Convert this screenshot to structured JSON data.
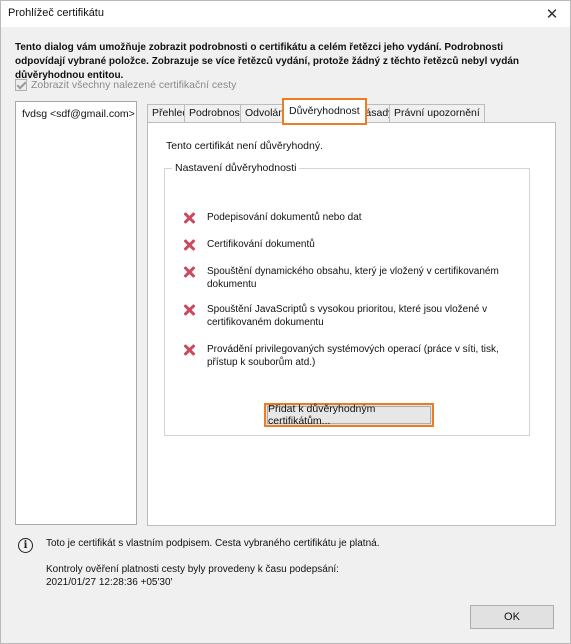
{
  "window": {
    "title": "Prohlížeč certifikátu",
    "intro": "Tento dialog vám umožňuje zobrazit podrobnosti o certifikátu a celém řetězci jeho vydání. Podrobnosti odpovídají vybrané položce. Zobrazuje se více řetězců vydání, protože žádný z těchto řetězců nebyl vydán důvěryhodnou entitou.",
    "show_all_label": "Zobrazit všechny nalezené certifikační cesty"
  },
  "cert_list": {
    "items": [
      "fvdsg <sdf@gmail.com>"
    ]
  },
  "tabs": [
    {
      "label": "Přehled"
    },
    {
      "label": "Podrobnosti"
    },
    {
      "label": "Odvolání"
    },
    {
      "label": "Důvěryhodnost"
    },
    {
      "label": "Zásady"
    },
    {
      "label": "Právní upozornění"
    }
  ],
  "trust_panel": {
    "status": "Tento certifikát není důvěryhodný.",
    "group_label": "Nastavení důvěryhodnosti",
    "items": [
      {
        "text": "Podepisování dokumentů nebo dat"
      },
      {
        "text": "Certifikování dokumentů"
      },
      {
        "text": "Spouštění dynamického obsahu, který je vložený v certifikovaném dokumentu"
      },
      {
        "text": "Spouštění JavaScriptů s vysokou prioritou, které jsou vložené v certifikovaném dokumentu"
      },
      {
        "text": "Provádění privilegovaných systémových operací (práce v síti, tisk, přístup k souborům atd.)"
      }
    ],
    "add_button": "Přidat k důvěryhodným certifikátům..."
  },
  "footer": {
    "info": "Toto je certifikát s vlastním podpisem. Cesta vybraného certifikátu je platná.",
    "check_line": "Kontroly ověření platnosti cesty byly provedeny k času podepsání:",
    "check_date": "2021/01/27 12:28:36 +05'30'",
    "ok_label": "OK"
  },
  "colors": {
    "highlight": "#f07c22",
    "denied": "#c84b5e"
  }
}
